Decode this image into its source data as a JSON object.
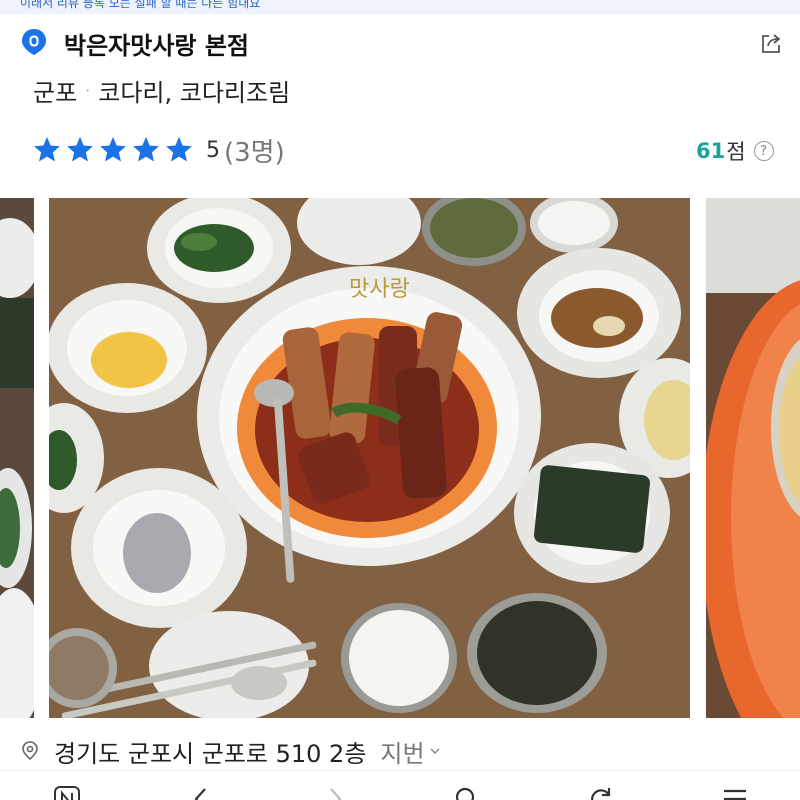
{
  "top_banner": {
    "text": "이래서 리뷰 등록 모는 실패 할 때는 다른 힘내요"
  },
  "place": {
    "name": "박은자맛사랑 본점",
    "region": "군포",
    "category": "코다리, 코다리조림"
  },
  "rating": {
    "stars": 5,
    "max_stars": 5,
    "score": "5",
    "count": "(3명)",
    "star_color": "#1a73e8"
  },
  "points": {
    "value": "61",
    "unit": "점",
    "help": "?"
  },
  "gallery": {
    "photos": [
      "side-photo-left",
      "main-photo-braised-pollock-table",
      "side-photo-right"
    ],
    "plate_text": "맛사랑"
  },
  "address": {
    "road": "경기도 군포시 군포로 510 2층",
    "jibun_label": "지번"
  },
  "icons": {
    "brand": "map-pin-icon",
    "share": "share-icon",
    "location": "location-pin-icon",
    "nav": [
      "home-n-icon",
      "back-icon",
      "forward-icon",
      "search-icon",
      "refresh-icon",
      "menu-icon"
    ]
  },
  "colors": {
    "brand_blue": "#1a73e8",
    "points_teal": "#1aa39a",
    "link_blue": "#2a64c8"
  }
}
